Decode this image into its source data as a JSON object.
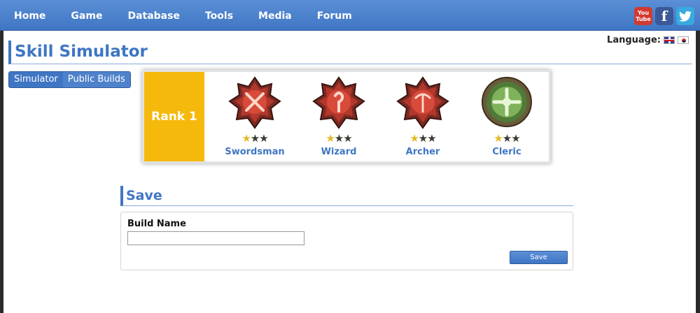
{
  "nav": {
    "items": [
      {
        "label": "Home"
      },
      {
        "label": "Game"
      },
      {
        "label": "Database"
      },
      {
        "label": "Tools"
      },
      {
        "label": "Media"
      },
      {
        "label": "Forum"
      }
    ]
  },
  "social": {
    "youtube_top": "You",
    "youtube_bottom": "Tube",
    "facebook": "f",
    "twitter_icon": "twitter-icon"
  },
  "language": {
    "label": "Language:",
    "flags": [
      "uk-flag-icon",
      "korea-flag-icon"
    ]
  },
  "page": {
    "title": "Skill Simulator"
  },
  "tabs": [
    {
      "label": "Simulator",
      "active": true
    },
    {
      "label": "Public Builds",
      "active": false
    }
  ],
  "rank": {
    "label": "Rank 1"
  },
  "classes": [
    {
      "name": "Swordsman",
      "icon": "swords-emblem-icon",
      "stars_filled": 1,
      "stars_total": 3
    },
    {
      "name": "Wizard",
      "icon": "wizard-emblem-icon",
      "stars_filled": 1,
      "stars_total": 3
    },
    {
      "name": "Archer",
      "icon": "bow-emblem-icon",
      "stars_filled": 1,
      "stars_total": 3
    },
    {
      "name": "Cleric",
      "icon": "cross-emblem-icon",
      "stars_filled": 1,
      "stars_total": 3
    }
  ],
  "save": {
    "title": "Save",
    "build_name_label": "Build Name",
    "build_name_value": "",
    "button_label": "Save"
  },
  "colors": {
    "accent": "#3f76c4",
    "rank_bg": "#f5b90c",
    "star": "#e6b823"
  }
}
